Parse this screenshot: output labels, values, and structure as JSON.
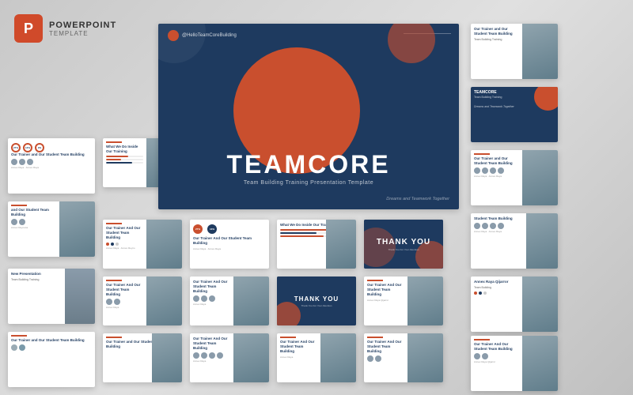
{
  "branding": {
    "icon_letter": "P",
    "title": "POWERPOINT",
    "subtitle": "TEMPLATE"
  },
  "hero": {
    "social_handle": "@HelloTeamCoreBuilding",
    "main_title": "TEAMCORE",
    "subtitle": "Team Building Training Presentation Template",
    "tagline": "Dreams and Teamwork Together"
  },
  "slides": {
    "titles": {
      "trainer_student": "Our Trainer and Our Student Team Building",
      "what_we_do": "What We Do Inside Our Training",
      "student_team": "Our Student Team Building",
      "our_trainer": "Our Trainer And Our Student Team Building",
      "thank_you": "THANK YOU",
      "thank_you_sub": "Thank You For Your Attention",
      "new": "New Presentation",
      "trainer_and": "Our Trainer And Our Student Team Building"
    }
  }
}
